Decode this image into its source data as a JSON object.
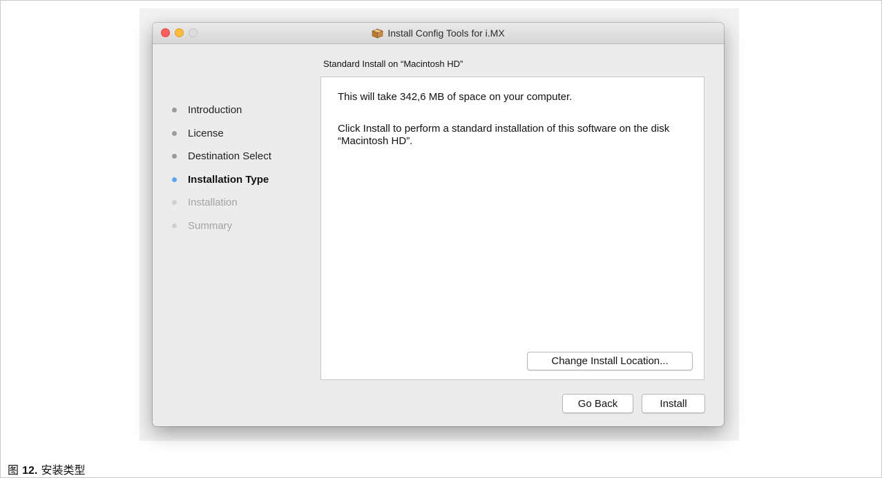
{
  "window": {
    "title": "Install Config Tools for i.MX"
  },
  "section_title": "Standard Install on “Macintosh HD”",
  "steps": [
    {
      "label": "Introduction",
      "state": "completed"
    },
    {
      "label": "License",
      "state": "completed"
    },
    {
      "label": "Destination Select",
      "state": "completed"
    },
    {
      "label": "Installation Type",
      "state": "active"
    },
    {
      "label": "Installation",
      "state": "pending"
    },
    {
      "label": "Summary",
      "state": "pending"
    }
  ],
  "content": {
    "space_text": "This will take 342,6 MB of space on your computer.",
    "install_text": "Click Install to perform a standard installation of this software on the disk “Macintosh HD”."
  },
  "buttons": {
    "change_location": "Change Install Location...",
    "go_back": "Go Back",
    "install": "Install"
  },
  "caption": {
    "prefix": "图",
    "number": "12.",
    "text": "安装类型"
  },
  "colors": {
    "active_step_dot": "#5aa6f0",
    "close": "#fc605c",
    "minimize": "#fdbc40",
    "zoom_disabled": "#dcdcdc"
  }
}
